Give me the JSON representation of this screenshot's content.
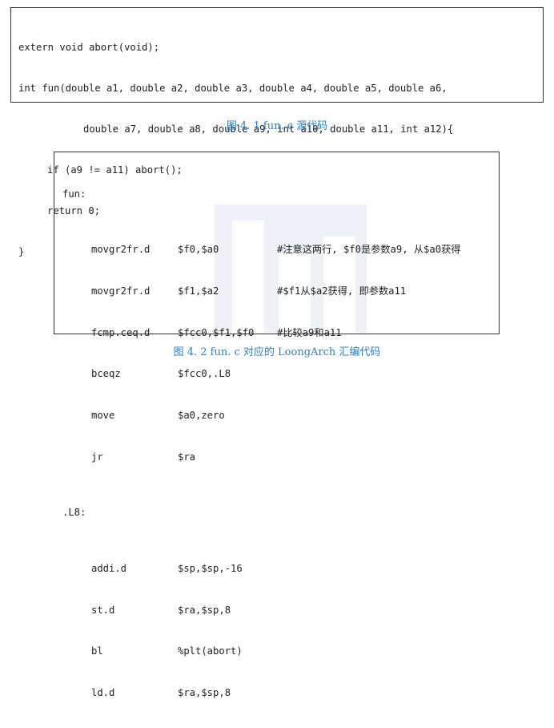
{
  "figure1": {
    "lines": [
      "extern void abort(void);",
      "int fun(double a1, double a2, double a3, double a4, double a5, double a6,",
      "double a7, double a8, double a9, int a10, double a11, int a12){",
      "if (a9 != a11) abort();",
      "return 0;",
      "}"
    ],
    "caption": "图 4. 1    fun. c 源代码"
  },
  "figure2": {
    "label_fun": "fun:",
    "instructions_a": [
      {
        "op": "movgr2fr.d",
        "args": "$f0,$a0",
        "comment": "#注意这两行, $f0是参数a9, 从$a0获得"
      },
      {
        "op": "movgr2fr.d",
        "args": "$f1,$a2",
        "comment": "#$f1从$a2获得, 即参数a11"
      },
      {
        "op": "fcmp.ceq.d",
        "args": "$fcc0,$f1,$f0",
        "comment": "#比较a9和a11"
      },
      {
        "op": "bceqz",
        "args": "$fcc0,.L8",
        "comment": ""
      },
      {
        "op": "move",
        "args": "$a0,zero",
        "comment": ""
      },
      {
        "op": "jr",
        "args": "$ra",
        "comment": ""
      }
    ],
    "label_l8": ".L8:",
    "instructions_b": [
      {
        "op": "addi.d",
        "args": "$sp,$sp,-16",
        "comment": ""
      },
      {
        "op": "st.d",
        "args": "$ra,$sp,8",
        "comment": ""
      },
      {
        "op": "bl",
        "args": "%plt(abort)",
        "comment": ""
      },
      {
        "op": "ld.d",
        "args": "$ra,$sp,8",
        "comment": ""
      }
    ],
    "caption": "图 4. 2    fun. c 对应的 LoongArch 汇编代码"
  },
  "colors": {
    "caption": "#2d7fbf",
    "text": "#222222",
    "border": "#333333",
    "watermark": "#eef1f6"
  }
}
